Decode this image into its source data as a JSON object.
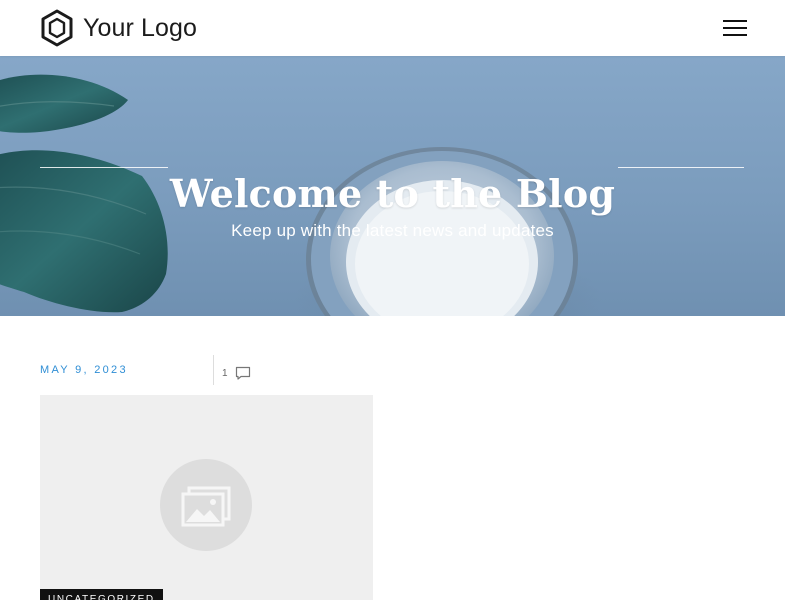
{
  "header": {
    "logo_text": "Your Logo",
    "logo_icon": "hexagon-logo-icon",
    "menu_icon": "hamburger-menu-icon"
  },
  "hero": {
    "title": "Welcome to the Blog",
    "subtitle": "Keep up with the latest news and updates",
    "background_subject": "coffee-cup-and-leaf"
  },
  "posts": [
    {
      "date": "MAY 9, 2023",
      "comment_count": "1",
      "comment_icon": "comment-icon",
      "image_icon": "image-placeholder-icon",
      "category": "UNCATEGORIZED"
    }
  ],
  "scrollbar": {
    "up_icon": "scroll-up-arrow-icon",
    "down_icon": "scroll-down-arrow-icon"
  },
  "colors": {
    "accent": "#2f8ed5",
    "hero_blue": "#7b9cbd",
    "text_dark": "#1b1b1b",
    "placeholder_bg": "#efefef",
    "badge_bg": "#111111"
  }
}
